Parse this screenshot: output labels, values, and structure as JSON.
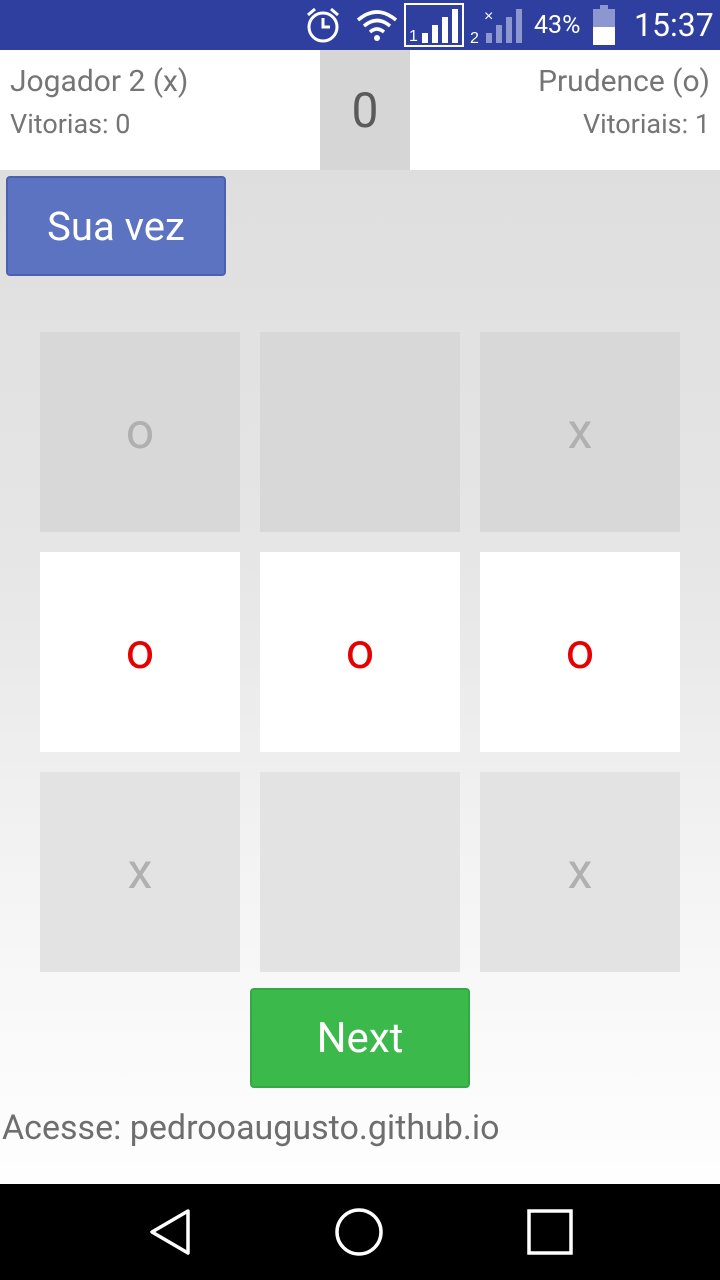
{
  "status_bar": {
    "battery_percent": "43%",
    "time": "15:37",
    "icons": [
      "alarm-icon",
      "wifi-icon",
      "signal-sim1-icon",
      "signal-sim2-icon",
      "battery-icon"
    ]
  },
  "header": {
    "player1_name": "Jogador 2 (x)",
    "player1_wins": "Vitorias: 0",
    "draws": "0",
    "player2_name": "Prudence (o)",
    "player2_wins": "Vitoriais: 1"
  },
  "turn_label": "Sua vez",
  "board": [
    [
      "o",
      "",
      "x"
    ],
    [
      "o",
      "o",
      "o"
    ],
    [
      "x",
      "",
      "x"
    ]
  ],
  "next_label": "Next",
  "footer_text": "Acesse: pedrooaugusto.github.io",
  "colors": {
    "status_bar": "#2f3f9f",
    "turn_button": "#5c73c2",
    "next_button": "#3bb94a",
    "winning_mark": "#e60000",
    "idle_mark": "#b0b0b0"
  },
  "nav_bar": {
    "icons": [
      "back-icon",
      "home-icon",
      "recent-apps-icon"
    ]
  }
}
